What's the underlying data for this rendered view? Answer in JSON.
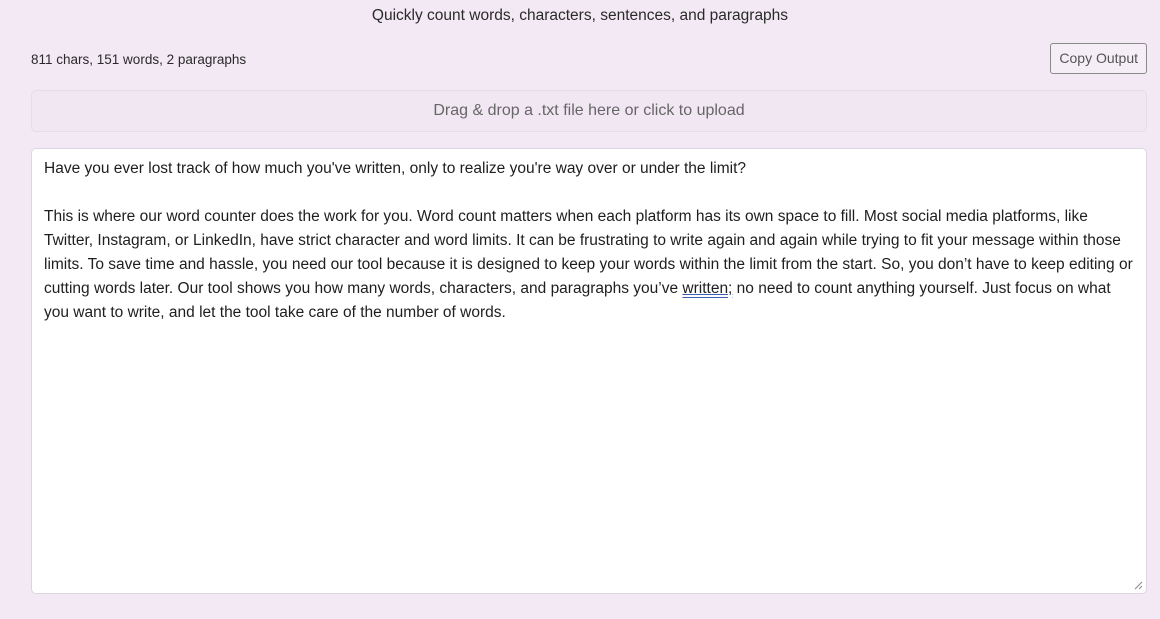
{
  "header": {
    "subtitle": "Quickly count words, characters, sentences, and paragraphs"
  },
  "stats": {
    "summary": "811 chars, 151 words, 2 paragraphs"
  },
  "toolbar": {
    "copy_label": "Copy Output"
  },
  "upload": {
    "label": "Drag & drop a .txt file here or click to upload"
  },
  "editor": {
    "paragraph_1": "Have you ever lost track of how much you've written, only to realize you're way over or under the limit?",
    "paragraph_2_before": "This is where our word counter does the work for you. Word count matters when each platform has its own space to fill. Most social media platforms, like Twitter, Instagram, or LinkedIn, have strict character and word limits. It can be frustrating to write again and again while trying to fit your message within those limits. To save time and hassle, you need our tool because it is designed to keep your words within the limit from the start. So, you don’t have to keep editing or cutting words later. Our tool shows you how many words, characters, and paragraphs you’ve ",
    "paragraph_2_flagged": "written;",
    "paragraph_2_after": " no need to count anything yourself. Just focus on what you want to write, and let the tool take care of the number of words."
  },
  "colors": {
    "background": "#f3e9f4",
    "editor_background": "#ffffff",
    "spellcheck_underline": "#3a5fb0"
  },
  "icons": {
    "resize": "resize-handle-icon"
  }
}
